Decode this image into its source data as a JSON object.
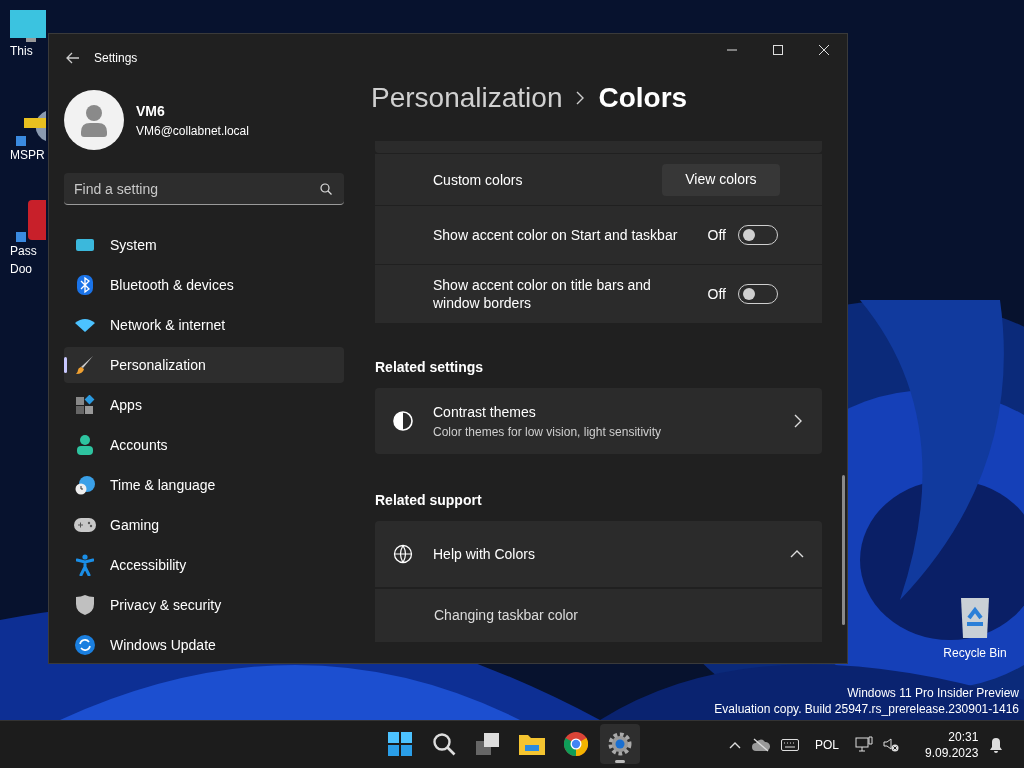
{
  "desktop": {
    "icons": [
      {
        "label": "This"
      },
      {
        "label": "MSPR"
      },
      {
        "label": "Pass"
      },
      {
        "label": "Doo"
      }
    ],
    "recycle_bin": {
      "label": "Recycle Bin"
    },
    "watermark": [
      "Windows 11 Pro Insider Preview",
      "Evaluation copy. Build 25947.rs_prerelease.230901-1416"
    ]
  },
  "window": {
    "title": "Settings",
    "user": {
      "name": "VM6",
      "email": "VM6@collabnet.local"
    },
    "search": {
      "placeholder": "Find a setting"
    },
    "nav": [
      {
        "label": "System",
        "selected": false
      },
      {
        "label": "Bluetooth & devices",
        "selected": false
      },
      {
        "label": "Network & internet",
        "selected": false
      },
      {
        "label": "Personalization",
        "selected": true
      },
      {
        "label": "Apps",
        "selected": false
      },
      {
        "label": "Accounts",
        "selected": false
      },
      {
        "label": "Time & language",
        "selected": false
      },
      {
        "label": "Gaming",
        "selected": false
      },
      {
        "label": "Accessibility",
        "selected": false
      },
      {
        "label": "Privacy & security",
        "selected": false
      },
      {
        "label": "Windows Update",
        "selected": false
      }
    ],
    "breadcrumb": [
      "Personalization",
      "Colors"
    ],
    "rows": [
      {
        "kind": "button",
        "label": "Custom colors",
        "button": "View colors"
      },
      {
        "kind": "toggle",
        "label": "Show accent color on Start and taskbar",
        "state_label": "Off",
        "on": false
      },
      {
        "kind": "toggle",
        "label": "Show accent color on title bars and window borders",
        "state_label": "Off",
        "on": false
      }
    ],
    "related_settings": {
      "heading": "Related settings",
      "items": [
        {
          "title": "Contrast themes",
          "subtitle": "Color themes for low vision, light sensitivity"
        }
      ]
    },
    "related_support": {
      "heading": "Related support",
      "title": "Help with Colors",
      "expanded": true,
      "links": [
        "Changing taskbar color"
      ]
    }
  },
  "taskbar": {
    "apps": [
      {
        "selected": false
      },
      {
        "selected": false
      },
      {
        "selected": false
      },
      {
        "selected": false
      },
      {
        "selected": false
      },
      {
        "selected": true
      }
    ],
    "language": "POL",
    "time": "20:31",
    "date": "9.09.2023"
  }
}
